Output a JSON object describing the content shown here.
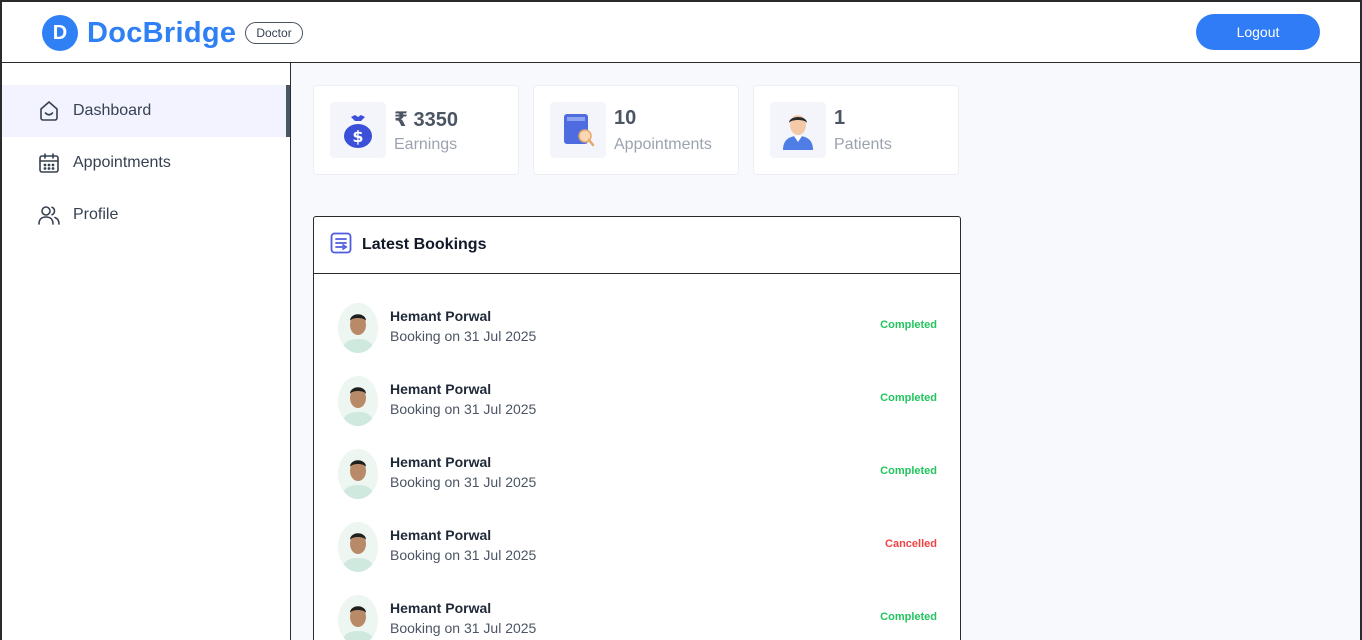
{
  "brand": {
    "initial": "D",
    "name": "DocBridge",
    "role": "Doctor"
  },
  "header": {
    "logout_label": "Logout"
  },
  "sidebar": {
    "items": [
      {
        "label": "Dashboard",
        "icon": "home-icon",
        "active": true
      },
      {
        "label": "Appointments",
        "icon": "calendar-icon",
        "active": false
      },
      {
        "label": "Profile",
        "icon": "people-icon",
        "active": false
      }
    ]
  },
  "stats": [
    {
      "value": "₹ 3350",
      "label": "Earnings",
      "icon": "money-bag-icon"
    },
    {
      "value": "10",
      "label": "Appointments",
      "icon": "appointments-book-icon"
    },
    {
      "value": "1",
      "label": "Patients",
      "icon": "patient-icon"
    }
  ],
  "bookings": {
    "title": "Latest Bookings",
    "icon": "list-icon",
    "items": [
      {
        "name": "Hemant Porwal",
        "date": "Booking on 31 Jul 2025",
        "status": "Completed"
      },
      {
        "name": "Hemant Porwal",
        "date": "Booking on 31 Jul 2025",
        "status": "Completed"
      },
      {
        "name": "Hemant Porwal",
        "date": "Booking on 31 Jul 2025",
        "status": "Completed"
      },
      {
        "name": "Hemant Porwal",
        "date": "Booking on 31 Jul 2025",
        "status": "Cancelled"
      },
      {
        "name": "Hemant Porwal",
        "date": "Booking on 31 Jul 2025",
        "status": "Completed"
      }
    ]
  },
  "colors": {
    "brand": "#2f80f5",
    "completed": "#22c55e",
    "cancelled": "#ef4444",
    "active_nav_bg": "#f2f3ff"
  }
}
